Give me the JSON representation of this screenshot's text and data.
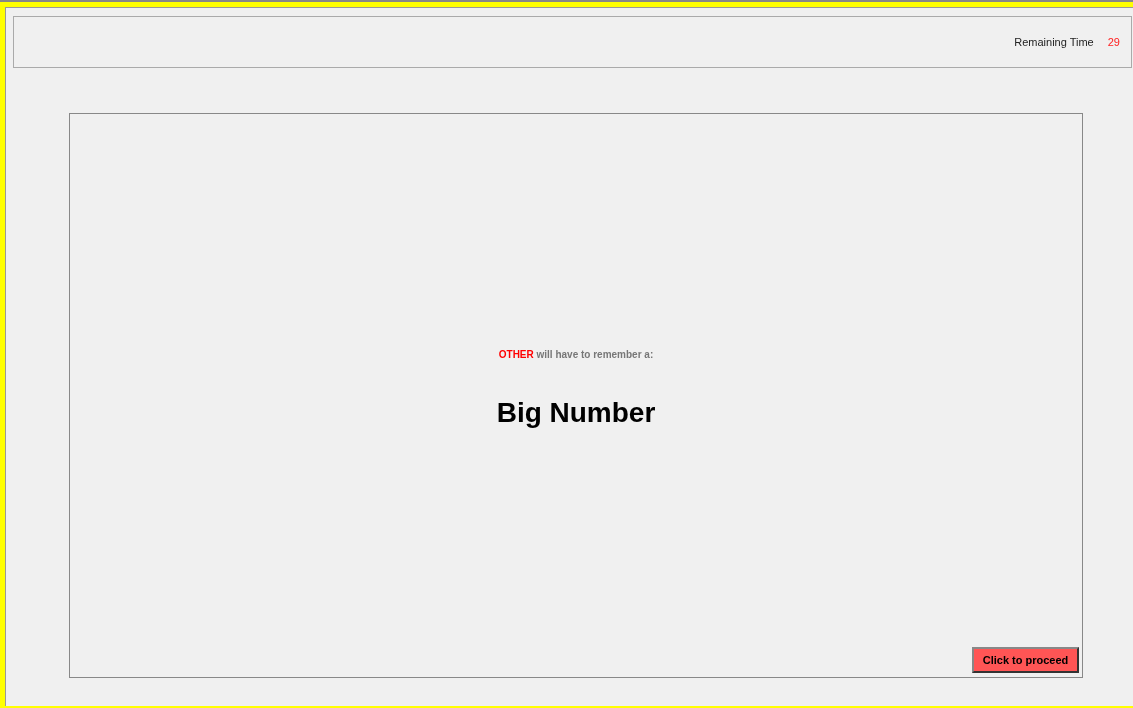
{
  "header": {
    "timer_label": "Remaining Time",
    "timer_value": "29"
  },
  "main": {
    "subject": "OTHER",
    "instruction": "will have to remember a:",
    "item": "Big Number",
    "button": "Click to proceed"
  }
}
